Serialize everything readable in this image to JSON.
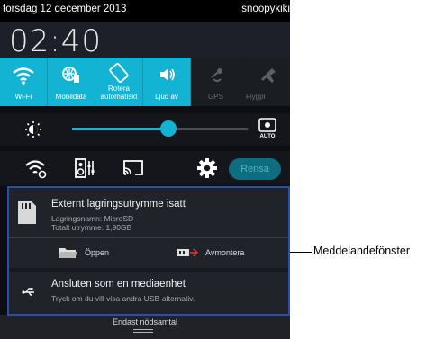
{
  "status_bar": {
    "date": "torsdag 12 december 2013",
    "user": "snoopykiki"
  },
  "clock": "02:40",
  "quick_tiles": [
    {
      "label": "Wi-Fi",
      "icon": "wifi-icon"
    },
    {
      "label": "Mobildata",
      "icon": "mobile-data-icon"
    },
    {
      "label": "Rotera automatiskt",
      "icon": "rotate-icon"
    },
    {
      "label": "Ljud av",
      "icon": "sound-off-icon"
    },
    {
      "label": "GPS",
      "icon": "gps-icon"
    },
    {
      "label": "Flygpl",
      "icon": "airplane-icon"
    }
  ],
  "brightness": {
    "level_fraction": 0.55,
    "auto_icon": "auto-brightness-icon"
  },
  "toolbar": {
    "clear_label": "Rensa"
  },
  "notifications": {
    "storage": {
      "title": "Externt lagringsutrymme isatt",
      "line1": "Lagringsnamn: MicroSD",
      "line2": "Totalt utrymme: 1,90GB",
      "open_label": "Öppen",
      "unmount_label": "Avmontera"
    },
    "usb": {
      "title": "Ansluten som en mediaenhet",
      "subtitle": "Tryck om du vill visa andra USB-alternativ."
    }
  },
  "emergency_label": "Endast nödsamtal",
  "callout": {
    "label": "Meddelandefönster"
  },
  "colors": {
    "accent": "#13b3d3",
    "frame": "#2b4fa8"
  }
}
